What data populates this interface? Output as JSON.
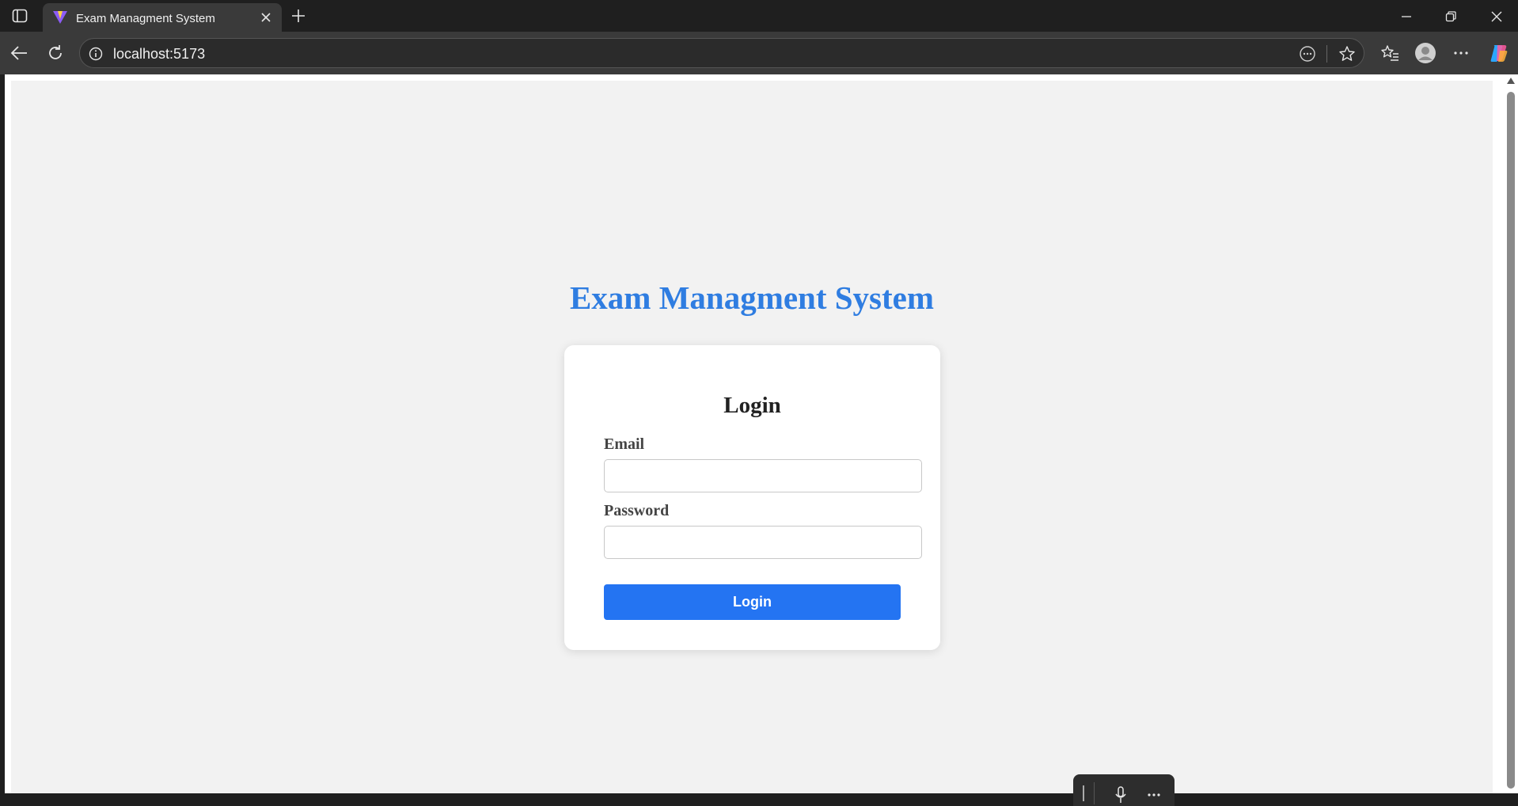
{
  "browser": {
    "tab_title": "Exam Managment System",
    "url": "localhost:5173"
  },
  "page": {
    "app_title": "Exam Managment System",
    "login_heading": "Login",
    "email_label": "Email",
    "email_value": "",
    "password_label": "Password",
    "password_value": "",
    "login_button": "Login"
  },
  "colors": {
    "title_blue": "#2f7de1",
    "button_blue": "#2474f2",
    "page_bg": "#f2f2f2"
  }
}
